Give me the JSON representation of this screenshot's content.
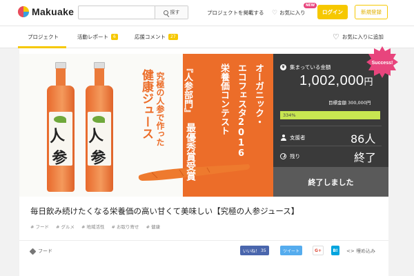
{
  "header": {
    "logo_text": "Makuake",
    "search": {
      "value": "",
      "placeholder": "",
      "button_label": "探す"
    },
    "post_project": "プロジェクトを掲載する",
    "favorites": "お気に入り",
    "new_badge": "NEW",
    "login": "ログイン",
    "signup": "新規登録"
  },
  "tabs": [
    {
      "label": "プロジェクト",
      "active": true
    },
    {
      "label": "活動レポート",
      "count": "6"
    },
    {
      "label": "応援コメント",
      "count": "27"
    }
  ],
  "add_favorite": "お気に入りに追加",
  "hero": {
    "juice_title": "健康ジュース",
    "juice_sub": "究極の人参で作った",
    "festival_lines": [
      "オーガニック・",
      "エコフェスタ2016",
      "栄養価コンテスト",
      "『人参部門』"
    ],
    "award": "最優秀賞受賞",
    "bottle_char": "人参"
  },
  "stats": {
    "collected_label": "集まっている金額",
    "amount": "1,002,000",
    "amount_unit": "円",
    "goal_label": "目標金額",
    "goal_value": "300,000円",
    "progress_percent": 334,
    "progress_label": "334%",
    "supporters_label": "支援者",
    "supporters_value": "86人",
    "remaining_label": "残り",
    "remaining_value": "終了",
    "success_badge": "Success!",
    "ended_button": "終了しました"
  },
  "project": {
    "title": "毎日飲み続けたくなる栄養価の高い甘くて美味しい【究極の人参ジュース】",
    "tags": [
      "# フード",
      "# グルメ",
      "# 地域活性",
      "# お取り寄せ",
      "# 健康"
    ],
    "category": "フード"
  },
  "share": {
    "fb_label": "いいね！",
    "fb_count": "35",
    "tweet_label": "ツイート",
    "gplus_label": "G+",
    "hatena_label": "B!",
    "embed_label": "埋め込み"
  },
  "colors": {
    "accent": "#f6c800",
    "orange": "#ec6d29",
    "progress": "#c8e651",
    "success": "#e8457d",
    "panel": "#3a3a3a"
  }
}
